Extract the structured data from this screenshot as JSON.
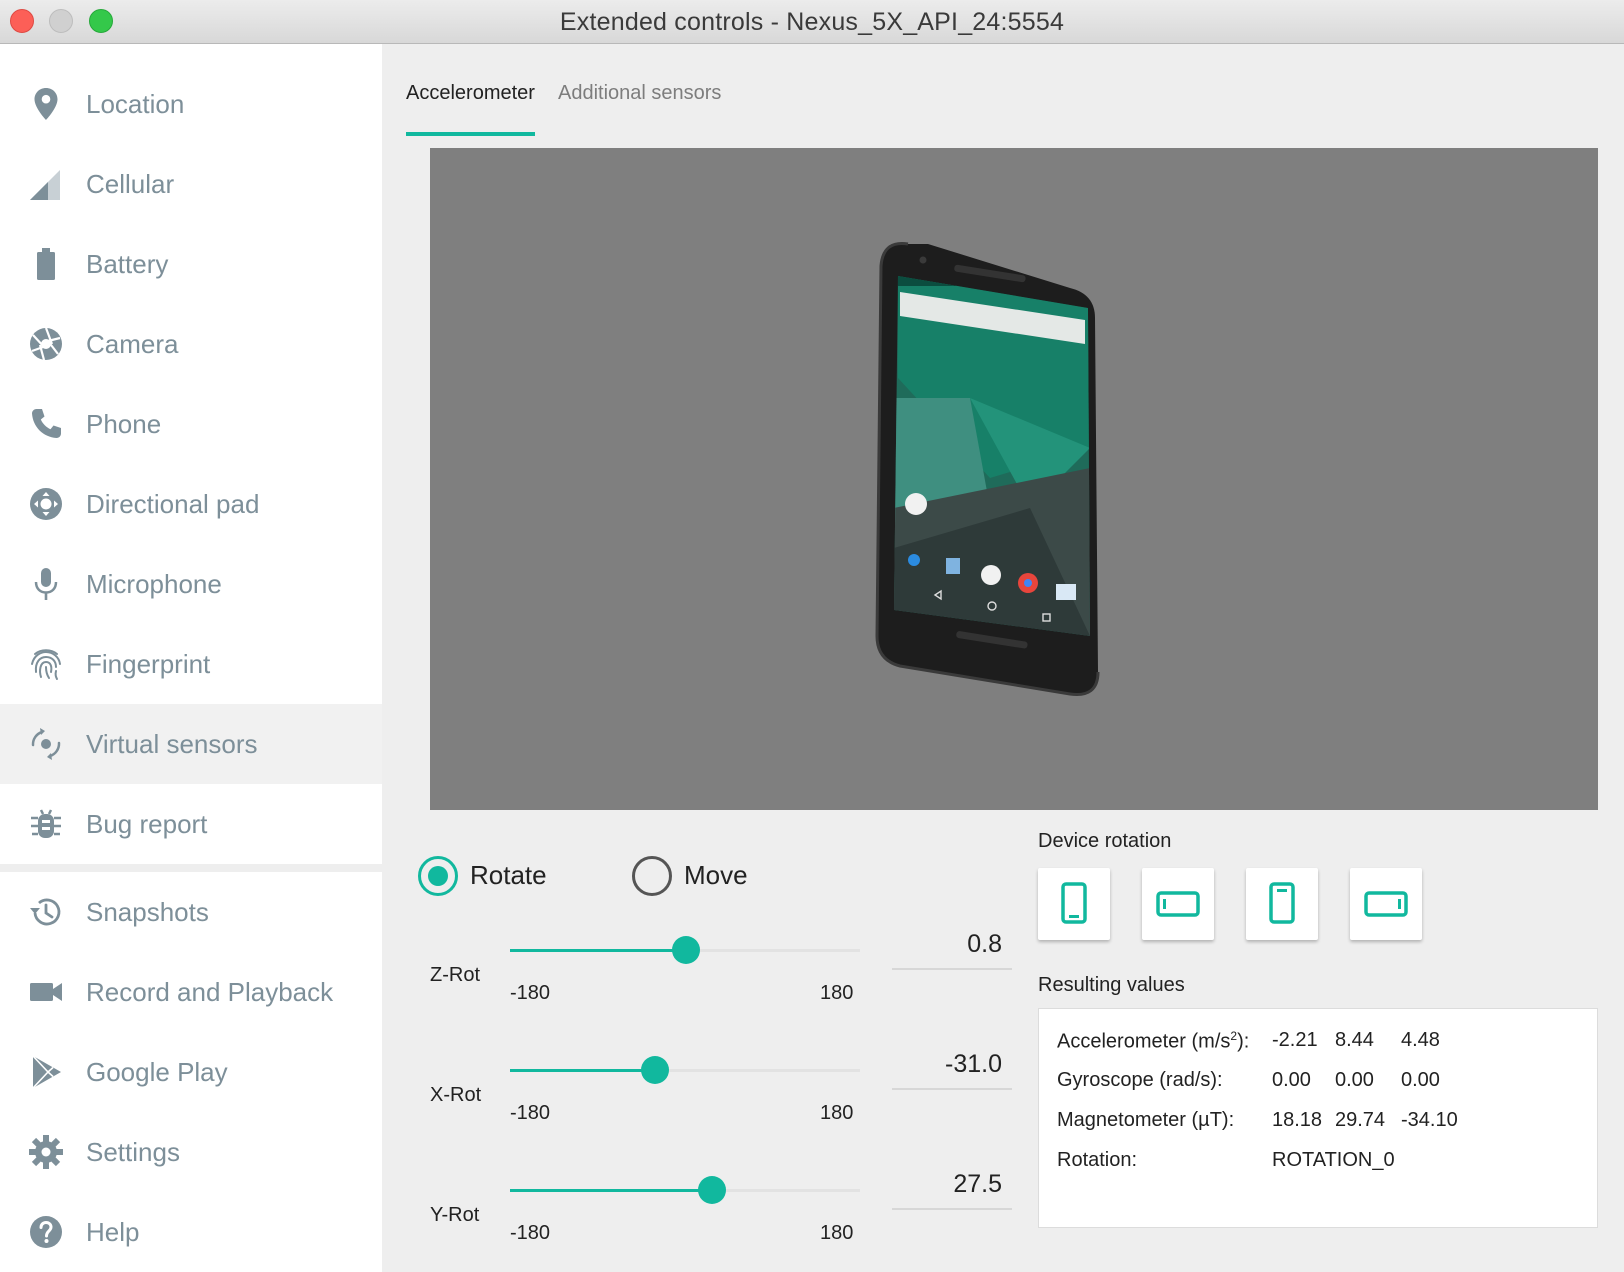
{
  "window": {
    "title": "Extended controls - Nexus_5X_API_24:5554"
  },
  "sidebar": {
    "items": [
      {
        "label": "Location",
        "icon": "location-pin-icon"
      },
      {
        "label": "Cellular",
        "icon": "cellular-signal-icon"
      },
      {
        "label": "Battery",
        "icon": "battery-icon"
      },
      {
        "label": "Camera",
        "icon": "camera-aperture-icon"
      },
      {
        "label": "Phone",
        "icon": "phone-icon"
      },
      {
        "label": "Directional pad",
        "icon": "dpad-icon"
      },
      {
        "label": "Microphone",
        "icon": "microphone-icon"
      },
      {
        "label": "Fingerprint",
        "icon": "fingerprint-icon"
      },
      {
        "label": "Virtual sensors",
        "icon": "virtual-sensors-icon",
        "active": true
      },
      {
        "label": "Bug report",
        "icon": "bug-icon"
      },
      {
        "label": "Snapshots",
        "icon": "history-icon"
      },
      {
        "label": "Record and Playback",
        "icon": "video-camera-icon"
      },
      {
        "label": "Google Play",
        "icon": "play-store-icon"
      },
      {
        "label": "Settings",
        "icon": "gear-icon"
      },
      {
        "label": "Help",
        "icon": "help-icon"
      }
    ]
  },
  "tabs": [
    {
      "label": "Accelerometer",
      "active": true
    },
    {
      "label": "Additional sensors",
      "active": false
    }
  ],
  "mode": {
    "rotate_label": "Rotate",
    "move_label": "Move",
    "selected": "Rotate"
  },
  "sliders": [
    {
      "label": "Z-Rot",
      "min": "-180",
      "max": "180",
      "value": "0.8"
    },
    {
      "label": "X-Rot",
      "min": "-180",
      "max": "180",
      "value": "-31.0"
    },
    {
      "label": "Y-Rot",
      "min": "-180",
      "max": "180",
      "value": "27.5"
    }
  ],
  "device_rotation": {
    "label": "Device rotation",
    "buttons": [
      {
        "icon": "portrait-icon"
      },
      {
        "icon": "landscape-icon"
      },
      {
        "icon": "reverse-portrait-icon"
      },
      {
        "icon": "reverse-landscape-icon"
      }
    ]
  },
  "results": {
    "label": "Resulting values",
    "accelerometer": {
      "label_prefix": "Accelerometer (m/s",
      "label_sup": "2",
      "label_suffix": "):",
      "x": "-2.21",
      "y": "8.44",
      "z": "4.48"
    },
    "gyroscope": {
      "label": "Gyroscope (rad/s):",
      "x": "0.00",
      "y": "0.00",
      "z": "0.00"
    },
    "magnetometer": {
      "label": "Magnetometer (µT):",
      "x": "18.18",
      "y": "29.74",
      "z": "-34.10"
    },
    "rotation": {
      "label": "Rotation:",
      "value": "ROTATION_0"
    }
  },
  "colors": {
    "accent": "#11b89e",
    "sidebar_text": "#7d8f99",
    "viewport_bg": "#7f7f7f"
  }
}
